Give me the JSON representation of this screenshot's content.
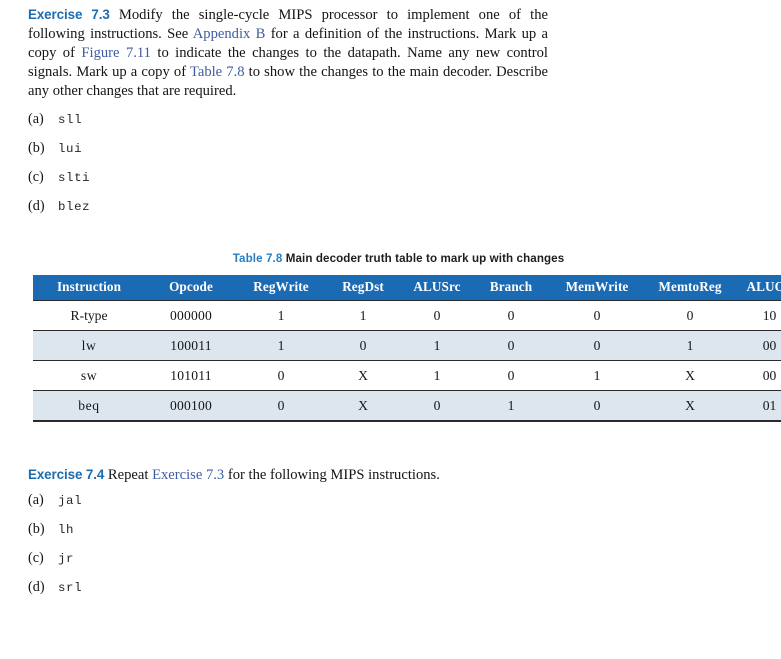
{
  "exercise_73": {
    "label": "Exercise 7.3",
    "body_parts": [
      {
        "text": " Modify the single-cycle MIPS processor to implement one of the following instructions. See ",
        "type": "plain"
      },
      {
        "text": "Appendix B",
        "type": "xref"
      },
      {
        "text": " for a definition of the instructions. Mark up a copy of ",
        "type": "plain"
      },
      {
        "text": "Figure 7.11",
        "type": "xref"
      },
      {
        "text": " to indicate the changes to the datapath. Name any new control signals. Mark up a copy of ",
        "type": "plain"
      },
      {
        "text": "Table 7.8",
        "type": "xref"
      },
      {
        "text": " to show the changes to the main decoder. Describe any other changes that are required.",
        "type": "plain"
      }
    ],
    "items": [
      {
        "marker": "(a)",
        "code": "sll"
      },
      {
        "marker": "(b)",
        "code": "lui"
      },
      {
        "marker": "(c)",
        "code": "slti"
      },
      {
        "marker": "(d)",
        "code": "blez"
      }
    ]
  },
  "exercise_74": {
    "label": "Exercise 7.4",
    "body_parts": [
      {
        "text": " Repeat ",
        "type": "plain"
      },
      {
        "text": "Exercise 7.3",
        "type": "xref"
      },
      {
        "text": " for the following MIPS instructions.",
        "type": "plain"
      }
    ],
    "items": [
      {
        "marker": "(a)",
        "code": "jal"
      },
      {
        "marker": "(b)",
        "code": "lh"
      },
      {
        "marker": "(c)",
        "code": "jr"
      },
      {
        "marker": "(d)",
        "code": "srl"
      }
    ]
  },
  "table": {
    "caption_number": "Table 7.8",
    "caption_text": "Main decoder truth table to mark up with changes",
    "columns": [
      "Instruction",
      "Opcode",
      "RegWrite",
      "RegDst",
      "ALUSrc",
      "Branch",
      "MemWrite",
      "MemtoReg",
      "ALUOp"
    ],
    "rows": [
      {
        "instruction": "R-type",
        "instruction_style": "serif",
        "shaded": false,
        "cells": [
          "000000",
          "1",
          "1",
          "0",
          "0",
          "0",
          "0",
          "10"
        ]
      },
      {
        "instruction": "lw",
        "instruction_style": "mono",
        "shaded": true,
        "cells": [
          "100011",
          "1",
          "0",
          "1",
          "0",
          "0",
          "1",
          "00"
        ]
      },
      {
        "instruction": "sw",
        "instruction_style": "mono",
        "shaded": false,
        "cells": [
          "101011",
          "0",
          "X",
          "1",
          "0",
          "1",
          "X",
          "00"
        ]
      },
      {
        "instruction": "beq",
        "instruction_style": "mono",
        "shaded": true,
        "cells": [
          "000100",
          "0",
          "X",
          "0",
          "1",
          "0",
          "X",
          "01"
        ]
      }
    ]
  },
  "colors": {
    "header_blue": "#1a6ab4",
    "exercise_label_blue": "#1c6cb0",
    "xref_blue": "#3f5ca0",
    "row_shade": "#dde5ef",
    "caption_blue": "#2a7ec0",
    "rule": "#2a2a2a",
    "page_background": "#ffffff"
  }
}
